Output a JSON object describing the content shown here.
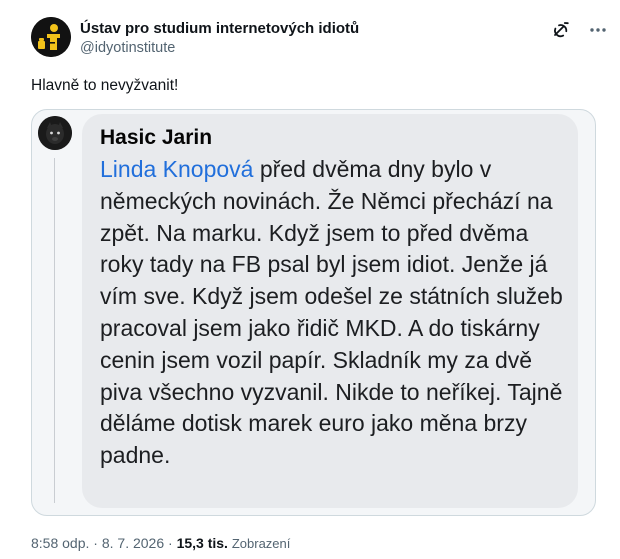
{
  "author": {
    "name": "Ústav pro studium internetových idiotů",
    "handle": "@idyotinstitute"
  },
  "tweet": {
    "text": "Hlavně to nevyžvanit!"
  },
  "embedded_post": {
    "author_name": "Hasic Jarin",
    "mention": "Linda Knopová",
    "body": " před dvěma dny bylo v německých novinách. Že Němci přechází na zpět. Na marku. Když jsem to před dvěma roky tady na FB psal byl jsem idiot. Jenže já vím sve. Když jsem odešel ze státních služeb pracoval jsem jako řidič MKD. A do tiskárny cenin jsem vozil papír. Skladník my za dvě piva všechno vyzvanil. Nikde to neříkej. Tajně děláme dotisk marek euro jako měna brzy padne."
  },
  "meta": {
    "time": "8:58 odp.",
    "separator": " · ",
    "date": "8. 7. 2026",
    "views_count": "15,3 tis.",
    "views_label": "Zobrazení"
  },
  "icons": {
    "grok": "grok-icon",
    "more": "more-icon"
  },
  "colors": {
    "text_primary": "#0f1419",
    "text_secondary": "#536471",
    "mention": "#216fdb",
    "bubble": "#e8eaed",
    "border": "#cfd9de"
  }
}
